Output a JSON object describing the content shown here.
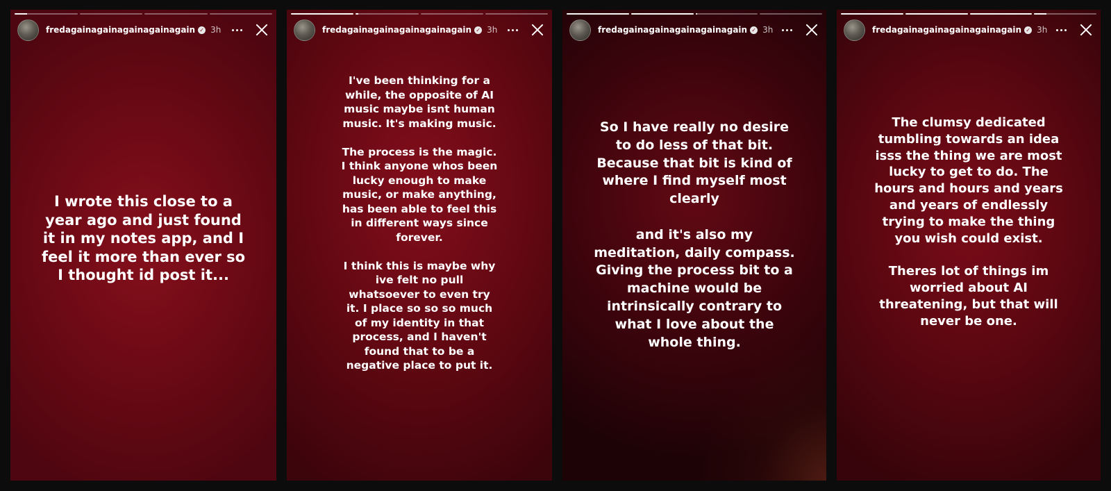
{
  "stories": [
    {
      "username": "fredagainagainagainagainagain",
      "time": "3h",
      "progress": [
        0.2,
        0,
        0,
        0
      ],
      "text": "I wrote this close to a year ago and just found it in my notes app, and I feel it more than ever so I thought id post it..."
    },
    {
      "username": "fredagainagainagainagainagain",
      "time": "3h",
      "progress": [
        1,
        0.04,
        0,
        0
      ],
      "text": "I've been thinking for a while, the opposite of AI music maybe isnt human music. It's making music.\n\nThe process is the magic. I think anyone whos been lucky enough to make music, or make anything, has been able to feel this in different ways since forever.\n\nI think this is maybe why ive felt no pull whatsoever to even try it. I place so so so much of my identity in that process, and I haven't found that to be a negative place to put it."
    },
    {
      "username": "fredagainagainagainagainagain",
      "time": "3h",
      "progress": [
        1,
        1,
        0.03,
        0
      ],
      "text": "So I have really no desire to do less of that bit. Because that bit is kind of where I find myself most clearly\n\nand it's also my meditation, daily compass. Giving the process bit to a machine would be intrinsically contrary to what I love about the whole thing."
    },
    {
      "username": "fredagainagainagainagainagain",
      "time": "3h",
      "progress": [
        1,
        1,
        1,
        0.2
      ],
      "text": "The clumsy dedicated tumbling towards an idea isss the thing we are most lucky to get to do. The hours and hours and years and years of endlessly trying to make the thing you wish could exist.\n\nTheres lot of things im worried about AI threatening, but that will never be one."
    }
  ],
  "icons": {
    "verified": "verified-badge-icon",
    "more": "more-dots-icon",
    "close": "close-x-icon"
  }
}
